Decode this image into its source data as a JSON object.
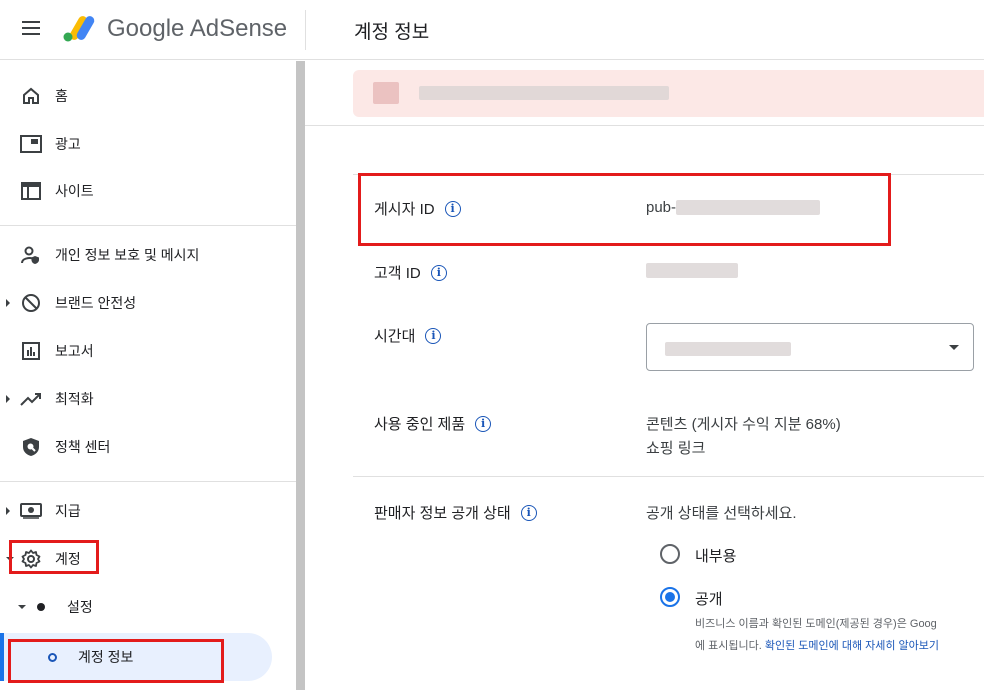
{
  "header": {
    "brand": "Google AdSense",
    "page_title": "계정 정보"
  },
  "sidebar": {
    "items": [
      {
        "label": "홈",
        "icon": "home-icon"
      },
      {
        "label": "광고",
        "icon": "ads-icon"
      },
      {
        "label": "사이트",
        "icon": "sites-icon"
      },
      {
        "label": "개인 정보 보호 및 메시지",
        "icon": "privacy-icon"
      },
      {
        "label": "브랜드 안전성",
        "icon": "block-icon"
      },
      {
        "label": "보고서",
        "icon": "reports-icon"
      },
      {
        "label": "최적화",
        "icon": "trending-icon"
      },
      {
        "label": "정책 센터",
        "icon": "policy-shield-icon"
      },
      {
        "label": "지급",
        "icon": "payments-icon"
      },
      {
        "label": "계정",
        "icon": "gear-icon"
      },
      {
        "label": "설정",
        "icon": "dot-icon"
      },
      {
        "label": "계정 정보",
        "icon": "circle-outline-icon"
      }
    ]
  },
  "account": {
    "publisher_id_label": "게시자 ID",
    "publisher_id_value": "pub-",
    "customer_id_label": "고객 ID",
    "timezone_label": "시간대",
    "products_label": "사용 중인 제품",
    "products": [
      "콘텐츠 (게시자 수익 지분 68%)",
      "쇼핑 링크"
    ],
    "seller_label": "판매자 정보 공개 상태",
    "seller_prompt": "공개 상태를 선택하세요.",
    "option_internal": "내부용",
    "option_public": "공개",
    "public_desc_1": "비즈니스 이름과 확인된 도메인(제공된 경우)은 Goog",
    "public_desc_2a": "에 표시됩니다. ",
    "public_desc_2b": "확인된 도메인에 대해 자세히 알아보기"
  },
  "colors": {
    "accent": "#1a73e8",
    "highlight": "#e31b1b",
    "banner": "#fce8e6",
    "active_nav": "#e8f0fe"
  }
}
